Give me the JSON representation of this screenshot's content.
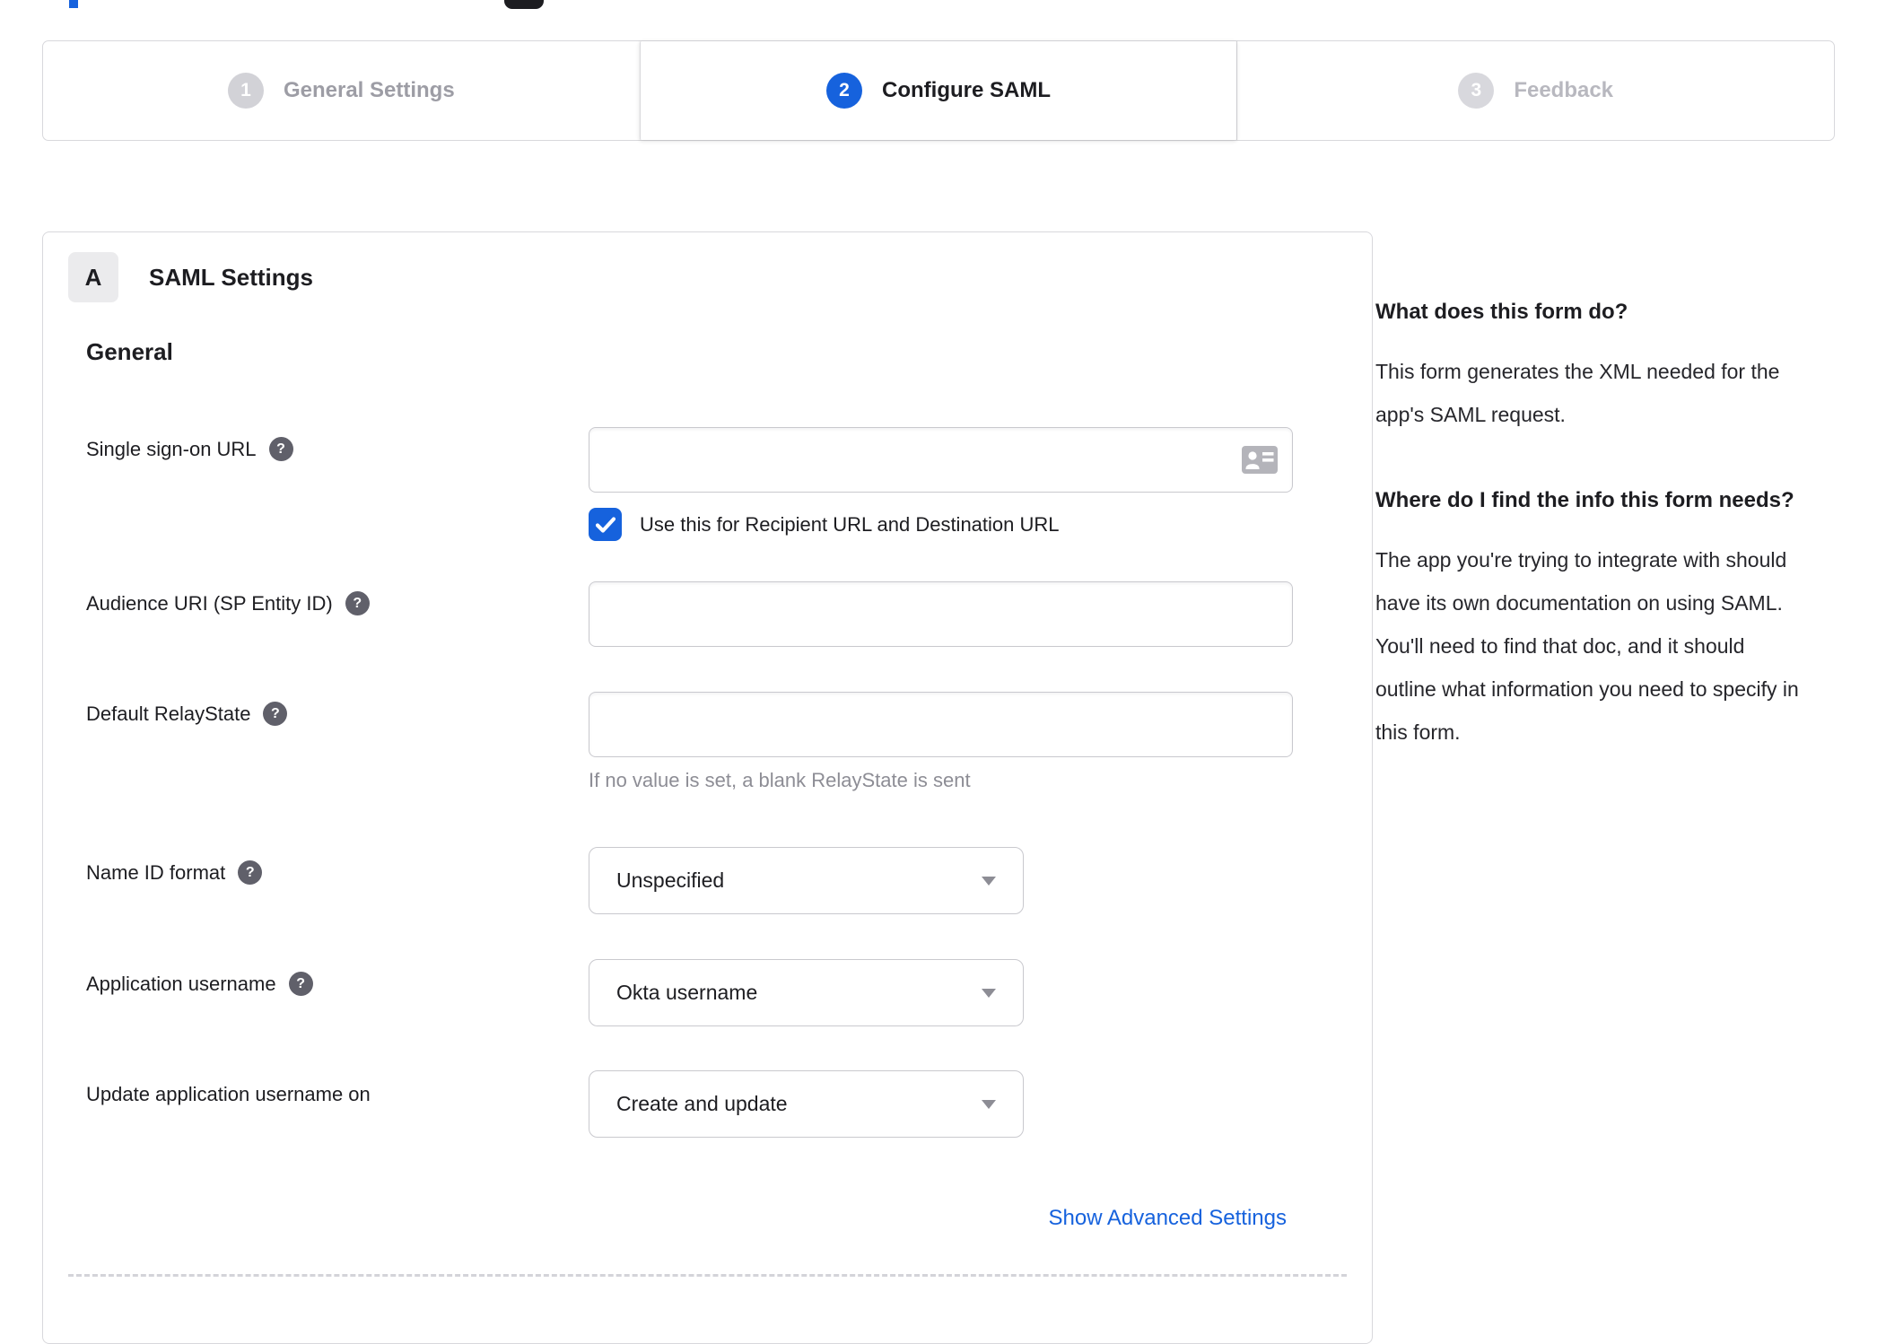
{
  "stepper": {
    "steps": [
      {
        "number": "1",
        "label": "General Settings",
        "state": "done"
      },
      {
        "number": "2",
        "label": "Configure SAML",
        "state": "active"
      },
      {
        "number": "3",
        "label": "Feedback",
        "state": "todo"
      }
    ]
  },
  "panel": {
    "section_badge": "A",
    "section_title": "SAML Settings",
    "group_title": "General"
  },
  "form": {
    "sso_url": {
      "label": "Single sign-on URL",
      "value": ""
    },
    "sso_checkbox": {
      "label": "Use this for Recipient URL and Destination URL",
      "checked": true
    },
    "audience_uri": {
      "label": "Audience URI (SP Entity ID)",
      "value": ""
    },
    "relay_state": {
      "label": "Default RelayState",
      "value": "",
      "hint": "If no value is set, a blank RelayState is sent"
    },
    "name_id_format": {
      "label": "Name ID format",
      "value": "Unspecified"
    },
    "app_username": {
      "label": "Application username",
      "value": "Okta username"
    },
    "update_username": {
      "label": "Update application username on",
      "value": "Create and update"
    },
    "advanced_link": "Show Advanced Settings"
  },
  "sidebar": {
    "question1": "What does this form do?",
    "answer1": "This form generates the XML needed for the app's SAML request.",
    "question2": "Where do I find the info this form needs?",
    "answer2": "The app you're trying to integrate with should have its own documentation on using SAML. You'll need to find that doc, and it should outline what information you need to specify in this form."
  },
  "icons": {
    "help": "question-circle",
    "sso_input_right": "address-card",
    "checkbox_mark": "checkmark",
    "select_right": "caret-down"
  },
  "colors": {
    "accent_blue": "#1662dd",
    "border_gray": "#d8d8dc",
    "muted_text": "#8d8d95",
    "dark_text": "#1d1d21"
  }
}
